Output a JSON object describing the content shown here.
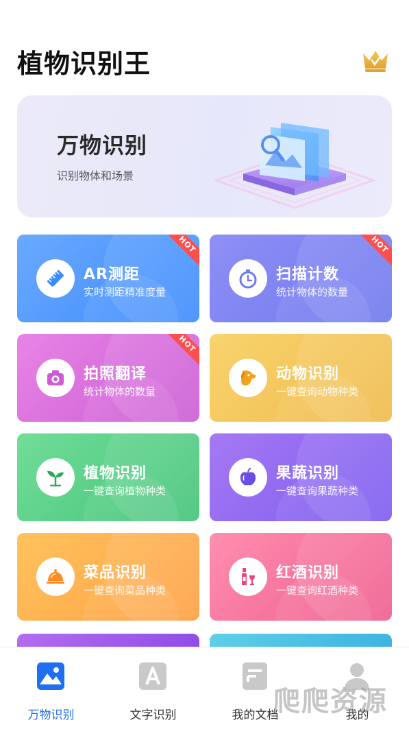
{
  "header": {
    "title": "植物识别王",
    "crown_icon": "crown-icon"
  },
  "hero": {
    "title": "万物识别",
    "subtitle": "识别物体和场景"
  },
  "cards": [
    {
      "title": "AR测距",
      "subtitle": "实时测距精准度量",
      "hot": "HOT",
      "icon": "ruler-icon",
      "color_from": "#6aa9ff",
      "color_to": "#3d8bfd"
    },
    {
      "title": "扫描计数",
      "subtitle": "统计物体的数量",
      "hot": "HOT",
      "icon": "stopwatch-icon",
      "color_from": "#8f8ff6",
      "color_to": "#6f79ee"
    },
    {
      "title": "拍照翻译",
      "subtitle": "统计物体的数量",
      "hot": "HOT",
      "icon": "camera-icon",
      "color_from": "#e884e6",
      "color_to": "#cb5cd5"
    },
    {
      "title": "动物识别",
      "subtitle": "一键查询动物种类",
      "icon": "dog-icon",
      "color_from": "#f8d36e",
      "color_to": "#f0bb4b"
    },
    {
      "title": "植物识别",
      "subtitle": "一键查询植物种类",
      "icon": "sprout-icon",
      "color_from": "#72dd98",
      "color_to": "#43c379"
    },
    {
      "title": "果蔬识别",
      "subtitle": "一键查询果蔬种类",
      "icon": "apple-icon",
      "color_from": "#a679f4",
      "color_to": "#7c5cf0"
    },
    {
      "title": "菜品识别",
      "subtitle": "一键查询菜品种类",
      "icon": "cloche-icon",
      "color_from": "#ffc35d",
      "color_to": "#ff9f43"
    },
    {
      "title": "红酒识别",
      "subtitle": "一键查询红酒种类",
      "icon": "wine-icon",
      "color_from": "#ff8fb0",
      "color_to": "#ef5d8e"
    }
  ],
  "tabs": [
    {
      "label": "万物识别",
      "active": true
    },
    {
      "label": "文字识别"
    },
    {
      "label": "我的文档"
    },
    {
      "label": "我的"
    }
  ],
  "watermark": "爬爬资源",
  "colors": {
    "accent": "#1f6ff2",
    "hot": "#ff4e4e"
  }
}
